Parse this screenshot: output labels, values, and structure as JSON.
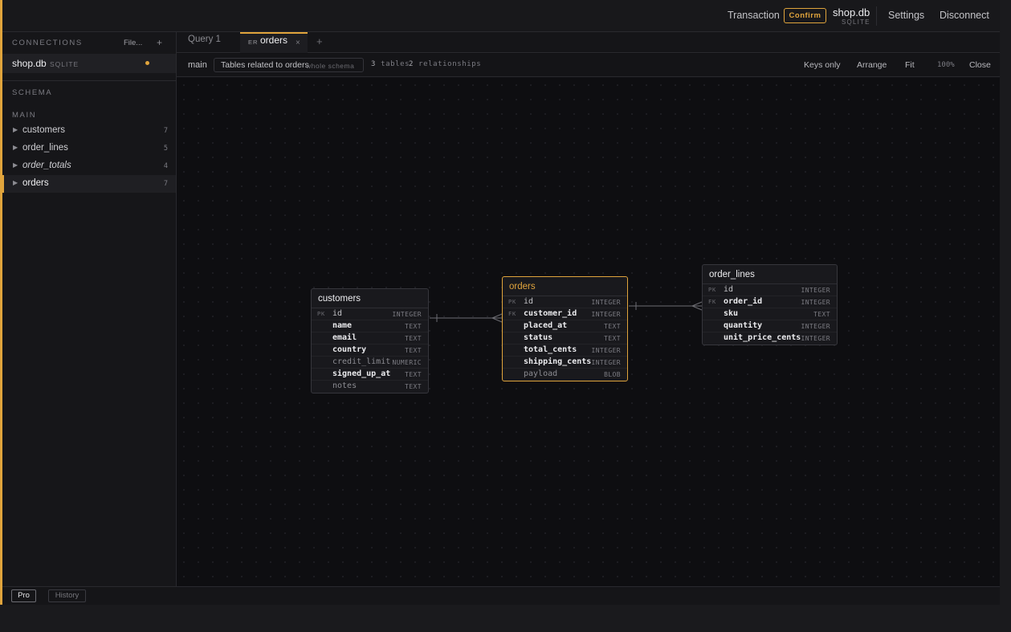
{
  "topbar": {
    "transaction_label": "Transaction",
    "confirm_label": "Confirm",
    "db_name": "shop.db",
    "db_engine": "SQLITE",
    "settings_label": "Settings",
    "disconnect_label": "Disconnect"
  },
  "sidebar": {
    "connections_heading": "CONNECTIONS",
    "file_label": "File...",
    "add_label": "+",
    "connection": {
      "name": "shop.db",
      "engine": "SQLITE",
      "status_color": "#e0a43c"
    },
    "schema_heading": "SCHEMA",
    "main_heading": "MAIN",
    "items": [
      {
        "label": "customers",
        "count": "7",
        "kind": "table",
        "active": false
      },
      {
        "label": "order_lines",
        "count": "5",
        "kind": "table",
        "active": false
      },
      {
        "label": "order_totals",
        "count": "4",
        "kind": "view",
        "active": false
      },
      {
        "label": "orders",
        "count": "7",
        "kind": "table",
        "active": true
      }
    ]
  },
  "tabs": [
    {
      "label": "Query 1",
      "kind": "",
      "active": false
    },
    {
      "label": "orders",
      "kind": "ER",
      "active": true,
      "close": "×"
    }
  ],
  "tab_add": "+",
  "er_toolbar": {
    "schema": "main",
    "scope_label": "Tables related to orders",
    "scope_alt": "whole schema",
    "tables_count": "3",
    "tables_word": "tables",
    "relationships_count": "2",
    "relationships_word": "relationships",
    "keys_only": "Keys only",
    "arrange": "Arrange",
    "fit": "Fit",
    "zoom": "100%",
    "close": "Close"
  },
  "er_tables": [
    {
      "name": "customers",
      "focus": false,
      "columns": [
        {
          "key": "PK",
          "name": "id",
          "type": "INTEGER",
          "style": "plain"
        },
        {
          "key": "",
          "name": "name",
          "type": "TEXT",
          "style": "bold"
        },
        {
          "key": "",
          "name": "email",
          "type": "TEXT",
          "style": "bold"
        },
        {
          "key": "",
          "name": "country",
          "type": "TEXT",
          "style": "bold"
        },
        {
          "key": "",
          "name": "credit_limit",
          "type": "NUMERIC",
          "style": "muted"
        },
        {
          "key": "",
          "name": "signed_up_at",
          "type": "TEXT",
          "style": "bold"
        },
        {
          "key": "",
          "name": "notes",
          "type": "TEXT",
          "style": "muted"
        }
      ]
    },
    {
      "name": "orders",
      "focus": true,
      "columns": [
        {
          "key": "PK",
          "name": "id",
          "type": "INTEGER",
          "style": "plain"
        },
        {
          "key": "FK",
          "name": "customer_id",
          "type": "INTEGER",
          "style": "bold"
        },
        {
          "key": "",
          "name": "placed_at",
          "type": "TEXT",
          "style": "bold"
        },
        {
          "key": "",
          "name": "status",
          "type": "TEXT",
          "style": "bold"
        },
        {
          "key": "",
          "name": "total_cents",
          "type": "INTEGER",
          "style": "bold"
        },
        {
          "key": "",
          "name": "shipping_cents",
          "type": "INTEGER",
          "style": "bold"
        },
        {
          "key": "",
          "name": "payload",
          "type": "BLOB",
          "style": "muted"
        }
      ]
    },
    {
      "name": "order_lines",
      "focus": false,
      "columns": [
        {
          "key": "PK",
          "name": "id",
          "type": "INTEGER",
          "style": "plain"
        },
        {
          "key": "FK",
          "name": "order_id",
          "type": "INTEGER",
          "style": "bold"
        },
        {
          "key": "",
          "name": "sku",
          "type": "TEXT",
          "style": "bold"
        },
        {
          "key": "",
          "name": "quantity",
          "type": "INTEGER",
          "style": "bold"
        },
        {
          "key": "",
          "name": "unit_price_cents",
          "type": "INTEGER",
          "style": "bold"
        }
      ]
    }
  ],
  "relationships": [
    {
      "from_table": "orders",
      "from_column": "customer_id",
      "to_table": "customers",
      "to_column": "id"
    },
    {
      "from_table": "order_lines",
      "from_column": "order_id",
      "to_table": "orders",
      "to_column": "id"
    }
  ],
  "statusbar": {
    "pro_label": "Pro",
    "history_label": "History"
  },
  "colors": {
    "accent": "#e0a43c",
    "background": "#111114"
  }
}
